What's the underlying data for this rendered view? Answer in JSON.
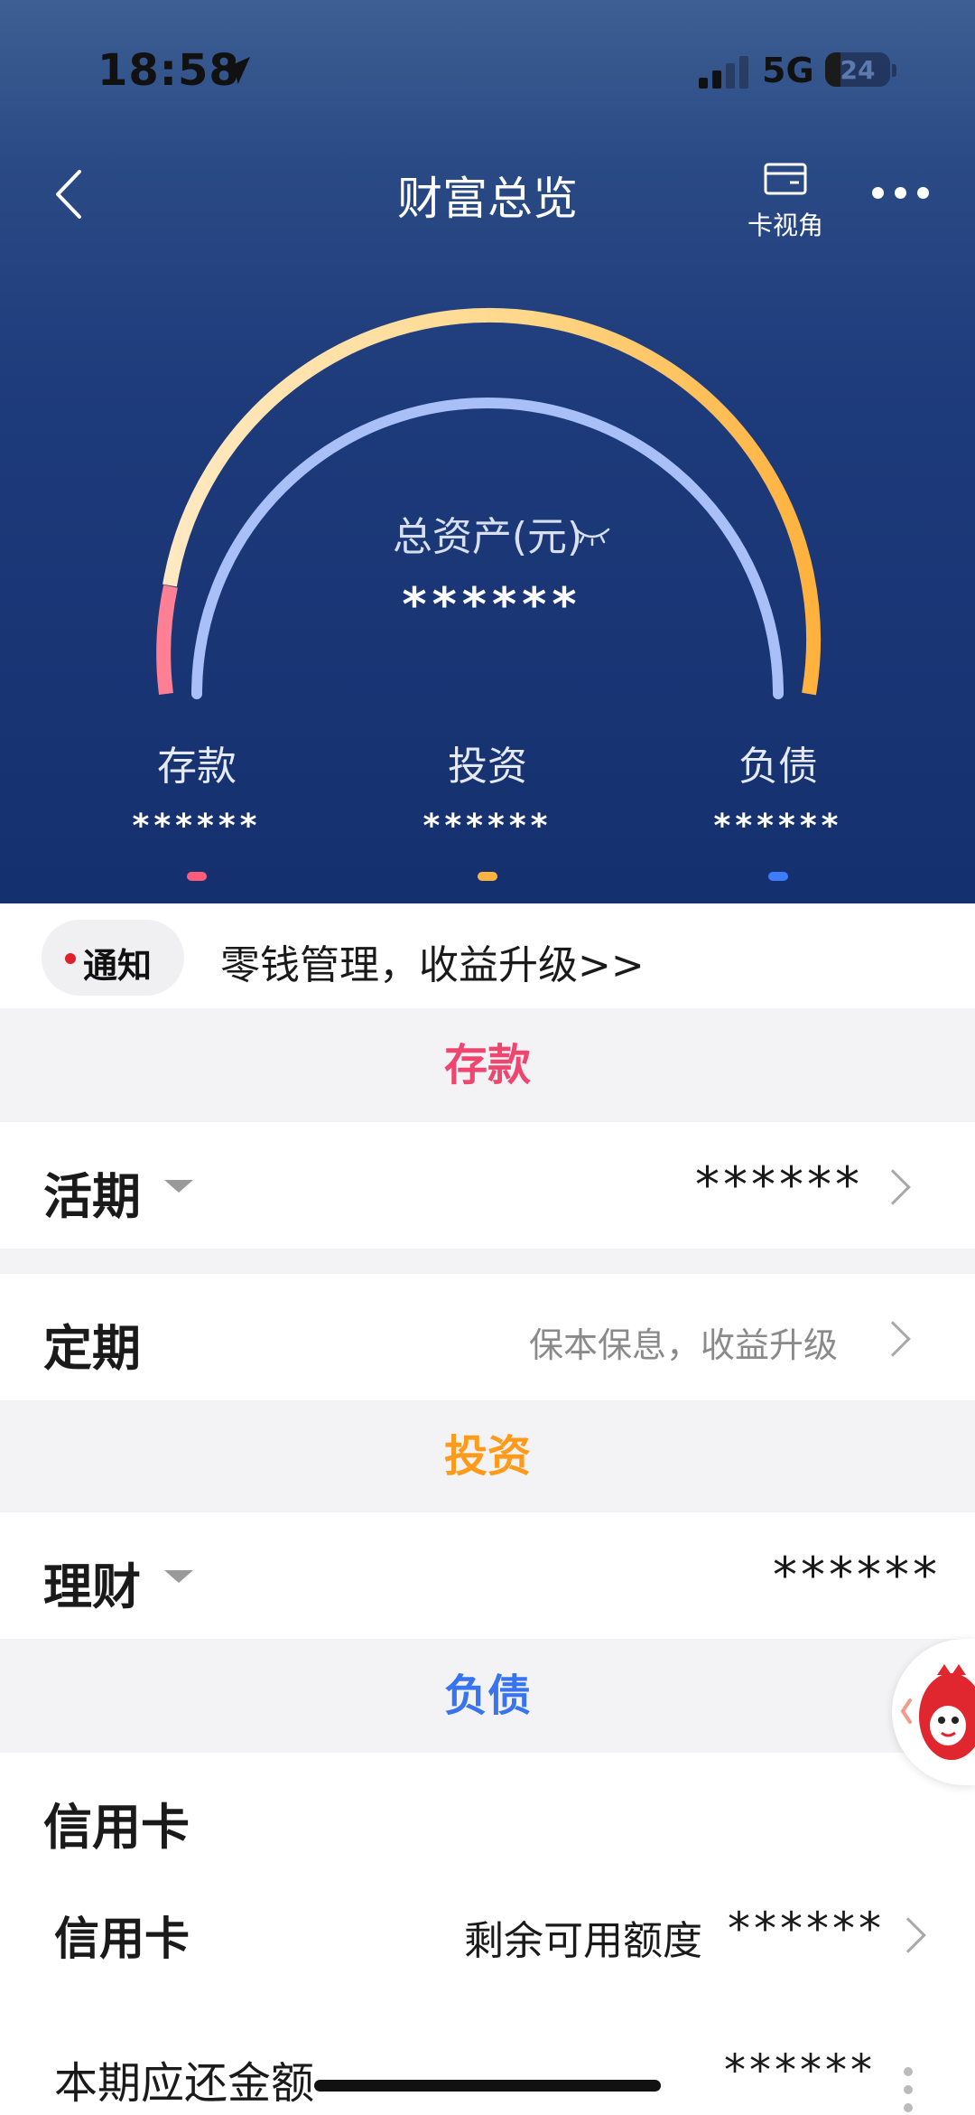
{
  "status_bar": {
    "time": "18:58",
    "network": "5G",
    "battery": "24",
    "battery_level": 0.24
  },
  "nav": {
    "title": "财富总览",
    "card_view_label": "卡视角"
  },
  "summary": {
    "total_label": "总资产(元)",
    "total_value": "******",
    "categories": [
      {
        "name": "存款",
        "value": "******",
        "color": "#ff5c7a"
      },
      {
        "name": "投资",
        "value": "******",
        "color": "#ffb340"
      },
      {
        "name": "负债",
        "value": "******",
        "color": "#3d7bff"
      }
    ]
  },
  "notice": {
    "badge": "通知",
    "text": "零钱管理，收益升级>>"
  },
  "sections": {
    "deposit": {
      "header": "存款",
      "header_color": "#f0456e",
      "current": {
        "title": "活期",
        "value": "******"
      },
      "fixed": {
        "title": "定期",
        "hint": "保本保息，收益升级"
      }
    },
    "investment": {
      "header": "投资",
      "header_color": "#ff9a1a",
      "wealth": {
        "title": "理财",
        "value": "******"
      }
    },
    "liability": {
      "header": "负债",
      "header_color": "#3873f0",
      "credit_group_title": "信用卡",
      "credit_card": {
        "title": "信用卡",
        "label": "剩余可用额度",
        "value": "******"
      },
      "due": {
        "title": "本期应还金额",
        "value": "******"
      }
    }
  }
}
